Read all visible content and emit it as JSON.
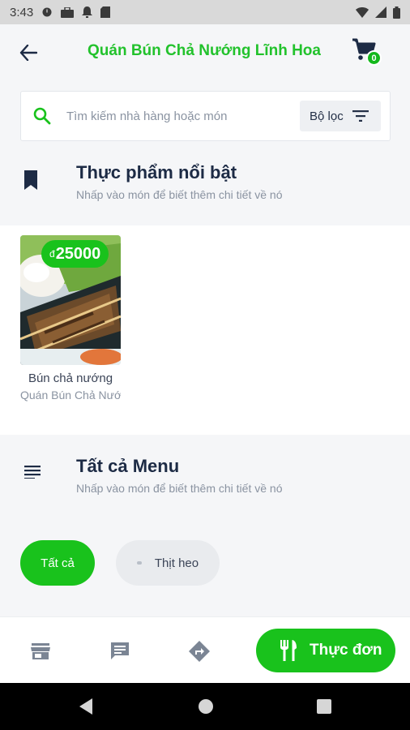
{
  "status_bar": {
    "time": "3:43",
    "left_icons": [
      "alarm-icon",
      "briefcase-icon",
      "notification-icon",
      "sim-icon"
    ],
    "right_icons": [
      "wifi-icon",
      "signal-icon",
      "battery-icon"
    ]
  },
  "app_bar": {
    "title": "Quán Bún Chả Nướng Lĩnh Hoa",
    "cart_count": "0"
  },
  "search": {
    "placeholder": "Tìm kiếm nhà hàng hoặc món",
    "filter_label": "Bộ lọc"
  },
  "featured": {
    "title": "Thực phẩm nổi bật",
    "subtitle": "Nhấp vào món để biết thêm chi tiết về nó",
    "items": [
      {
        "currency": "đ",
        "price": "25000",
        "name": "Bún chả nướng",
        "restaurant": "Quán Bún Chả Nướng Lĩnh Hoa"
      }
    ]
  },
  "menu": {
    "title": "Tất cả Menu",
    "subtitle": "Nhấp vào món để biết thêm chi tiết về nó",
    "chips": [
      {
        "label": "Tất cả",
        "active": true
      },
      {
        "label": "Thịt heo",
        "active": false
      }
    ]
  },
  "bottom_nav": {
    "items": [
      "store-icon",
      "chat-icon",
      "directions-icon"
    ],
    "active_label": "Thực đơn"
  },
  "colors": {
    "accent": "#19c21c",
    "title_text": "#1d2b45",
    "muted_text": "#8a93a1"
  }
}
